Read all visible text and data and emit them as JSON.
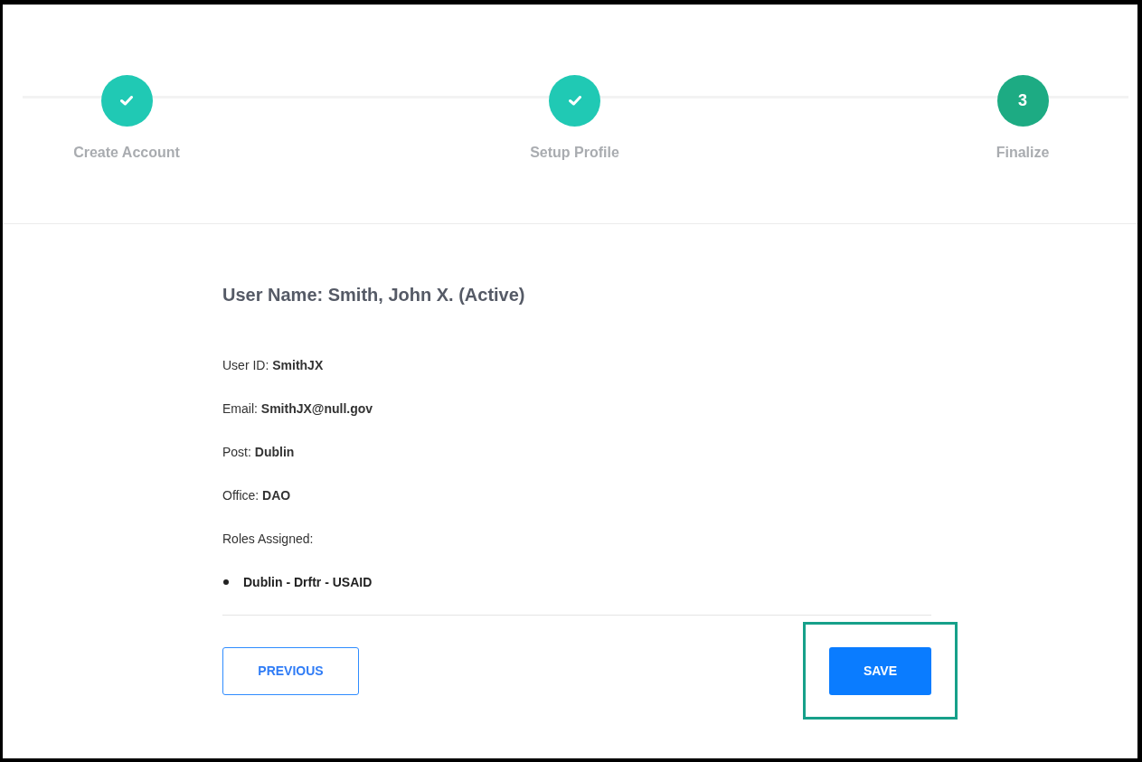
{
  "steps": [
    {
      "label": "Create Account",
      "completed": true
    },
    {
      "label": "Setup Profile",
      "completed": true
    },
    {
      "label": "Finalize",
      "completed": false,
      "number": "3"
    }
  ],
  "heading": "User Name: Smith, John X. (Active)",
  "fields": [
    {
      "text": "User ID: **SmithJX**"
    },
    {
      "text": "Email: **SmithJX@null.gov**"
    },
    {
      "text": "Post: **Dublin**"
    },
    {
      "text": "Office: **DAO**"
    }
  ],
  "roles": {
    "label": "Roles Assigned:",
    "items": [
      "Dublin - Drftr - USAID"
    ]
  },
  "buttons": [
    {
      "label": "PREVIOUS",
      "kind": "outline",
      "highlighted": false
    },
    {
      "label": "SAVE",
      "kind": "primary",
      "highlighted": true
    }
  ]
}
